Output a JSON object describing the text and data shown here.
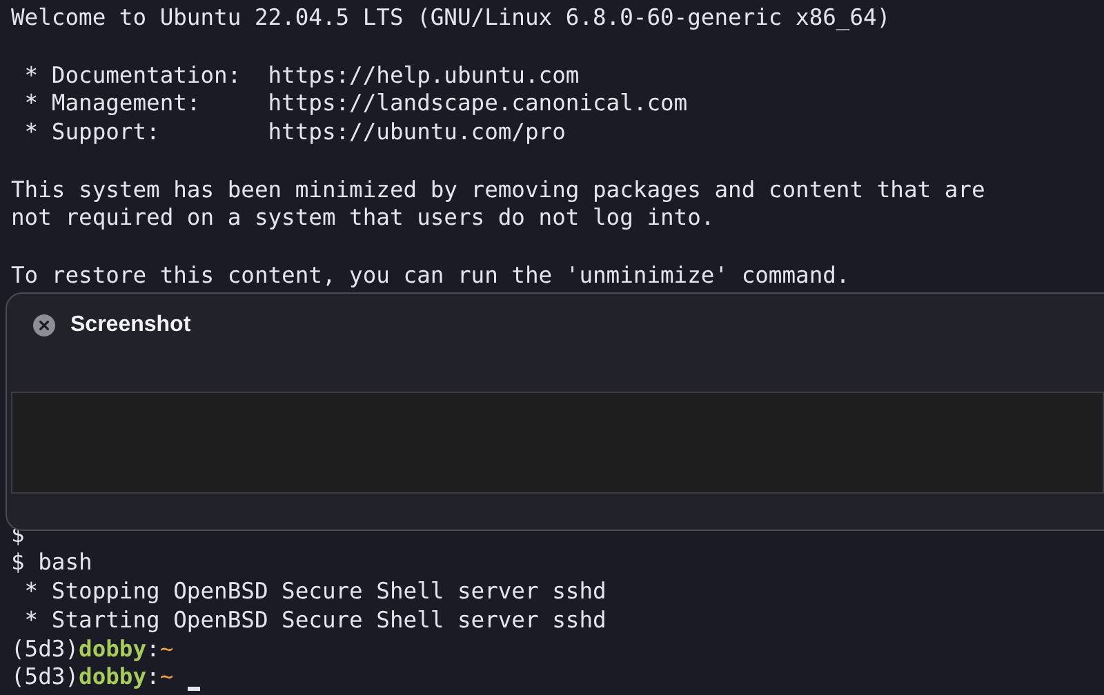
{
  "terminal": {
    "lines_above": [
      "Welcome to Ubuntu 22.04.5 LTS (GNU/Linux 6.8.0-60-generic x86_64)",
      {
        "gap_before": true,
        "text": " * Documentation:  https://help.ubuntu.com"
      },
      " * Management:     https://landscape.canonical.com",
      " * Support:        https://ubuntu.com/pro",
      {
        "gap_before": true,
        "text": "This system has been minimized by removing packages and content that are"
      },
      "not required on a system that users do not log into.",
      {
        "gap_before": true,
        "text": "To restore this content, you can run the 'unminimize' command."
      }
    ],
    "lines_below": [
      {
        "kind": "output",
        "text": "$"
      },
      {
        "kind": "output",
        "text": "$ bash"
      },
      {
        "kind": "output",
        "text": " * Stopping OpenBSD Secure Shell server sshd"
      },
      {
        "kind": "output",
        "text": " * Starting OpenBSD Secure Shell server sshd"
      },
      {
        "kind": "prompt",
        "env": "(5d3)",
        "user": "dobby",
        "sep": ":",
        "path": "~",
        "cursor": false
      },
      {
        "kind": "prompt",
        "env": "(5d3)",
        "user": "dobby",
        "sep": ":",
        "path": "~",
        "cursor": true
      }
    ]
  },
  "notification": {
    "title": "Screenshot"
  }
}
